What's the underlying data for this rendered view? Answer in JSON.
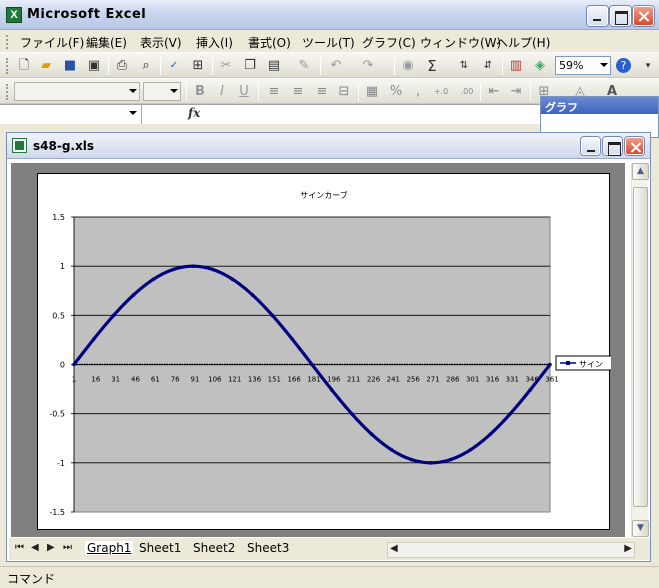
{
  "app": {
    "title": "Microsoft Excel",
    "icon_letter": "X"
  },
  "menu": {
    "items": [
      "ファイル(F)",
      "編集(E)",
      "表示(V)",
      "挿入(I)",
      "書式(O)",
      "ツール(T)",
      "グラフ(C)",
      "ウィンドウ(W)",
      "ヘルプ(H)"
    ]
  },
  "toolbar": {
    "zoom": "59%",
    "icons": [
      "new-icon",
      "open-icon",
      "save-icon",
      "permission-icon",
      "print-icon",
      "print-preview-icon",
      "spelling-icon",
      "research-icon",
      "cut-icon",
      "copy-icon",
      "paste-icon",
      "format-painter-icon",
      "undo-icon",
      "redo-icon",
      "hyperlink-icon",
      "autosum-icon",
      "sort-asc-icon",
      "sort-desc-icon",
      "chart-wizard-icon",
      "drawing-icon",
      "help-icon"
    ],
    "format_icons": [
      "bold-icon",
      "italic-icon",
      "underline-icon",
      "align-left-icon",
      "align-center-icon",
      "align-right-icon",
      "merge-center-icon",
      "currency-icon",
      "percent-icon",
      "comma-icon",
      "increase-decimal-icon",
      "decrease-decimal-icon",
      "decrease-indent-icon",
      "increase-indent-icon",
      "borders-icon",
      "fill-color-icon",
      "font-color-icon"
    ],
    "format_labels": {
      "bold": "B",
      "italic": "I",
      "underline": "U",
      "percent": "%",
      "comma": ",",
      "inc_dec": "+.0 .00",
      "dec_dec": ".00 +.0",
      "font_color": "A"
    }
  },
  "chart_toolbar": {
    "title": "グラフ"
  },
  "formula_bar": {
    "fx": "fx",
    "name_box": "",
    "content": ""
  },
  "workbook": {
    "filename": "s48-g.xls"
  },
  "sheets": {
    "tabs": [
      "Graph1",
      "Sheet1",
      "Sheet2",
      "Sheet3"
    ],
    "active": "Graph1"
  },
  "status": {
    "text": "コマンド"
  },
  "colors": {
    "plot_bg": "#c0c0c0",
    "series": "#000080",
    "gridline": "#000000",
    "axis_label": "#000000"
  },
  "chart_data": {
    "type": "line",
    "title": "サインカーブ",
    "xlabel": "",
    "ylabel": "",
    "ylim": [
      -1.5,
      1.5
    ],
    "yticks": [
      -1.5,
      -1,
      -0.5,
      0,
      0.5,
      1,
      1.5
    ],
    "ytick_labels": [
      "-1.5",
      "-1",
      "-0.5",
      "0",
      "0.5",
      "1",
      "1.5"
    ],
    "xticks": [
      1,
      16,
      31,
      46,
      61,
      76,
      91,
      106,
      121,
      136,
      151,
      166,
      181,
      196,
      211,
      226,
      241,
      256,
      271,
      286,
      301,
      316,
      331,
      346,
      361
    ],
    "x_range": [
      1,
      361
    ],
    "grid": true,
    "legend": "right",
    "series": [
      {
        "name": "サイン",
        "x": [
          1,
          16,
          31,
          46,
          61,
          76,
          91,
          106,
          121,
          136,
          151,
          166,
          181,
          196,
          211,
          226,
          241,
          256,
          271,
          286,
          301,
          316,
          331,
          346,
          361
        ],
        "values": [
          0,
          0.259,
          0.5,
          0.707,
          0.866,
          0.966,
          1,
          0.966,
          0.866,
          0.707,
          0.5,
          0.259,
          0,
          -0.259,
          -0.5,
          -0.707,
          -0.866,
          -0.966,
          -1,
          -0.966,
          -0.866,
          -0.707,
          -0.5,
          -0.259,
          0
        ]
      }
    ]
  }
}
